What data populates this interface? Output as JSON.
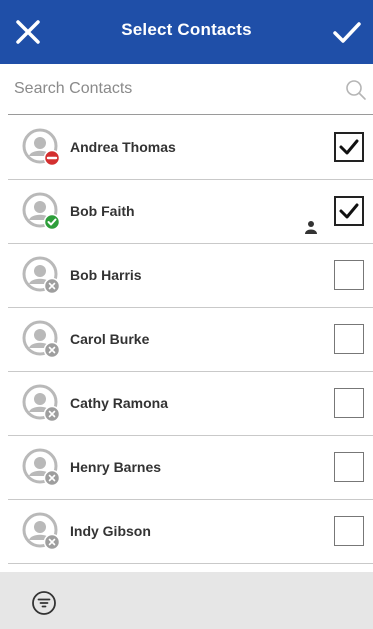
{
  "header": {
    "title": "Select Contacts",
    "background": "#1f4fa8",
    "close_icon": "close-icon",
    "confirm_icon": "checkmark-icon"
  },
  "search": {
    "placeholder": "Search Contacts",
    "value": "",
    "icon": "search-icon"
  },
  "contacts": [
    {
      "name": "Andrea Thomas",
      "status": "busy",
      "status_color": "#d32f2f",
      "checked": true,
      "extra_icon": null
    },
    {
      "name": "Bob Faith",
      "status": "available",
      "status_color": "#2e9e3a",
      "checked": true,
      "extra_icon": "person-icon"
    },
    {
      "name": "Bob Harris",
      "status": "offline",
      "status_color": "#9e9e9e",
      "checked": false,
      "extra_icon": null
    },
    {
      "name": "Carol Burke",
      "status": "offline",
      "status_color": "#9e9e9e",
      "checked": false,
      "extra_icon": null
    },
    {
      "name": "Cathy Ramona",
      "status": "offline",
      "status_color": "#9e9e9e",
      "checked": false,
      "extra_icon": null
    },
    {
      "name": "Henry Barnes",
      "status": "offline",
      "status_color": "#9e9e9e",
      "checked": false,
      "extra_icon": null
    },
    {
      "name": "Indy Gibson",
      "status": "offline",
      "status_color": "#9e9e9e",
      "checked": false,
      "extra_icon": null
    },
    {
      "name": "",
      "status": "offline",
      "status_color": "#9e9e9e",
      "checked": false,
      "extra_icon": null
    }
  ],
  "footer": {
    "filter_icon": "filter-icon"
  }
}
